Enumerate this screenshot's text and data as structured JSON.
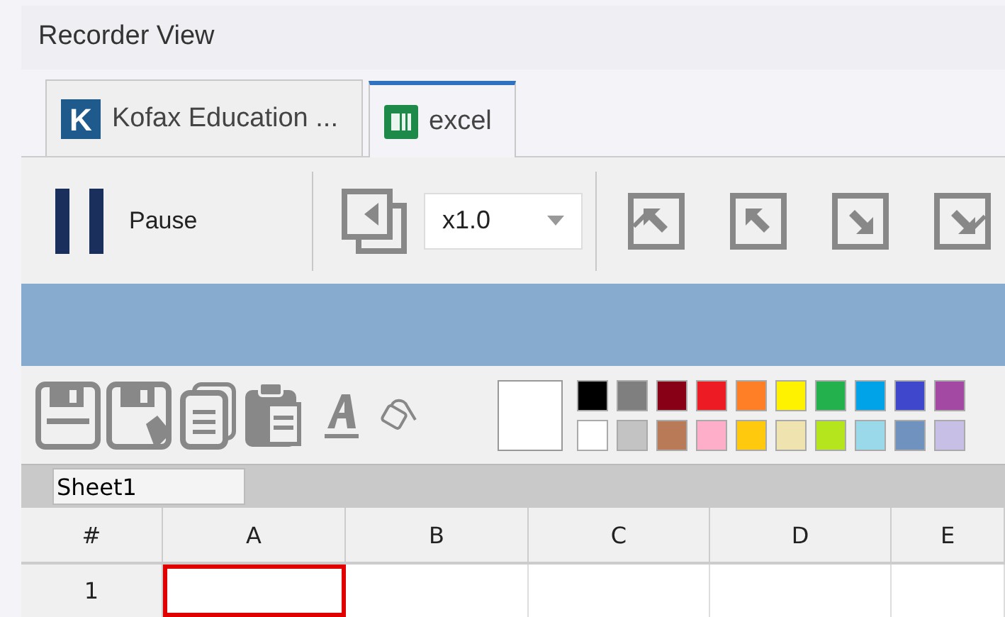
{
  "window": {
    "title": "Recorder View"
  },
  "tabs": [
    {
      "kind": "kofax",
      "logo_letter": "K",
      "label": "Kofax Education ...",
      "selected": false
    },
    {
      "kind": "excel",
      "label": "excel",
      "selected": true
    }
  ],
  "toolbar": {
    "pause_label": "Pause",
    "speed": "x1.0"
  },
  "palette": {
    "swatches": [
      {
        "color": "#000000"
      },
      {
        "color": "#7f7f7f"
      },
      {
        "color": "#880015"
      },
      {
        "color": "#ed1c24"
      },
      {
        "color": "#ff7f27"
      },
      {
        "color": "#fff200"
      },
      {
        "color": "#22b14c"
      },
      {
        "color": "#00a2e8"
      },
      {
        "color": "#3f48cc"
      },
      {
        "color": "#a349a4"
      },
      {
        "color": "#ffffff"
      },
      {
        "color": "#c3c3c3"
      },
      {
        "color": "#b97a57"
      },
      {
        "color": "#ffaec9"
      },
      {
        "color": "#ffc90e"
      },
      {
        "color": "#efe4b0"
      },
      {
        "color": "#b5e61d"
      },
      {
        "color": "#99d9ea"
      },
      {
        "color": "#7092be"
      },
      {
        "color": "#c8bfe7"
      }
    ]
  },
  "sheet_tab": "Sheet1",
  "table": {
    "corner": "#",
    "columns": [
      "A",
      "B",
      "C",
      "D",
      "E"
    ],
    "rows": [
      {
        "header": "1",
        "cells": [
          {
            "selected": true
          },
          {
            "selected": false
          },
          {
            "selected": false
          },
          {
            "selected": false
          },
          {
            "selected": false
          }
        ]
      }
    ]
  }
}
